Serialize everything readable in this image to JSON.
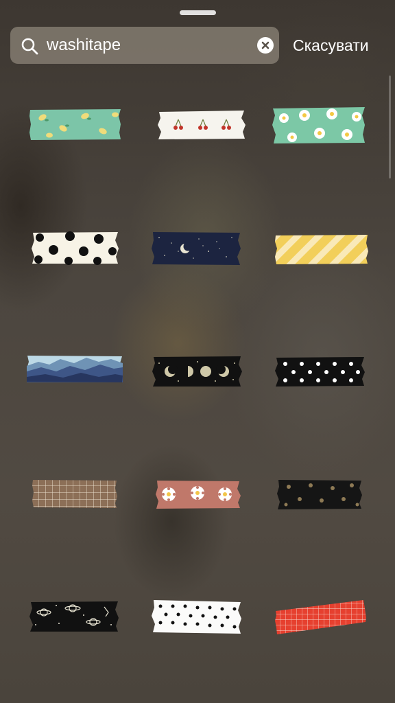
{
  "search": {
    "query": "washitape",
    "cancel_label": "Скасувати"
  },
  "icons": {
    "search": "search-icon",
    "clear": "clear-icon"
  },
  "stickers": [
    {
      "name": "sticker-lemon-tape"
    },
    {
      "name": "sticker-cherry-tape"
    },
    {
      "name": "sticker-daisy-mint-tape"
    },
    {
      "name": "sticker-polka-cream-tape"
    },
    {
      "name": "sticker-night-moon-tape"
    },
    {
      "name": "sticker-yellow-stripe-tape"
    },
    {
      "name": "sticker-mountain-tape"
    },
    {
      "name": "sticker-moon-phases-tape"
    },
    {
      "name": "sticker-black-white-dots-tape"
    },
    {
      "name": "sticker-brown-grid-tape"
    },
    {
      "name": "sticker-terracotta-daisy-tape"
    },
    {
      "name": "sticker-black-brown-dots-tape"
    },
    {
      "name": "sticker-space-planets-tape"
    },
    {
      "name": "sticker-white-black-dots-tape"
    },
    {
      "name": "sticker-red-grid-tape"
    }
  ],
  "colors": {
    "mint": "#7cc5a8",
    "cream": "#f6f1e4",
    "navy": "#1c2440",
    "yellow": "#f2cf5a",
    "terracotta": "#c0786a",
    "red": "#e6402f",
    "brown": "#8c6f57"
  }
}
